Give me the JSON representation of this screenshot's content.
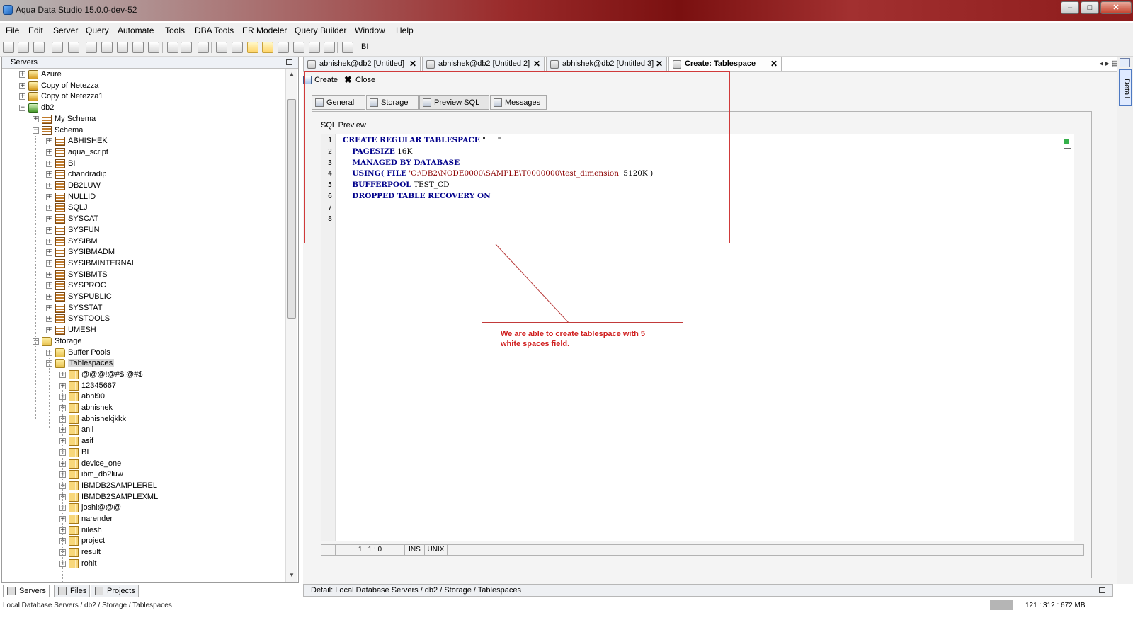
{
  "window": {
    "title": "Aqua Data Studio 15.0.0-dev-52",
    "min": "–",
    "max": "□",
    "close": "✕"
  },
  "menu": [
    "File",
    "Edit",
    "Server",
    "Query",
    "Automate",
    "Tools",
    "DBA Tools",
    "ER Modeler",
    "Query Builder",
    "Window",
    "Help"
  ],
  "toolbar": {
    "bi_label": "BI"
  },
  "servers_panel": {
    "title": "Servers"
  },
  "tree": [
    {
      "label": "Azure",
      "level": 0,
      "icon": "server-icon",
      "expanded": false
    },
    {
      "label": "Copy of Netezza",
      "level": 0,
      "icon": "server-icon",
      "expanded": false
    },
    {
      "label": "Copy of Netezza1",
      "level": 0,
      "icon": "server-icon",
      "expanded": false
    },
    {
      "label": "db2",
      "level": 0,
      "icon": "db2-icon",
      "expanded": true
    },
    {
      "label": "My Schema",
      "level": 1,
      "icon": "schema-icon",
      "expanded": false
    },
    {
      "label": "Schema",
      "level": 1,
      "icon": "schema-icon",
      "expanded": true
    },
    {
      "label": "ABHISHEK",
      "level": 2,
      "icon": "schema-icon",
      "expanded": false
    },
    {
      "label": "aqua_script",
      "level": 2,
      "icon": "schema-icon",
      "expanded": false
    },
    {
      "label": "BI",
      "level": 2,
      "icon": "schema-icon",
      "expanded": false
    },
    {
      "label": "chandradip",
      "level": 2,
      "icon": "schema-icon",
      "expanded": false
    },
    {
      "label": "DB2LUW",
      "level": 2,
      "icon": "schema-icon",
      "expanded": false
    },
    {
      "label": "NULLID",
      "level": 2,
      "icon": "schema-icon",
      "expanded": false
    },
    {
      "label": "SQLJ",
      "level": 2,
      "icon": "schema-icon",
      "expanded": false
    },
    {
      "label": "SYSCAT",
      "level": 2,
      "icon": "schema-icon",
      "expanded": false
    },
    {
      "label": "SYSFUN",
      "level": 2,
      "icon": "schema-icon",
      "expanded": false
    },
    {
      "label": "SYSIBM",
      "level": 2,
      "icon": "schema-icon",
      "expanded": false
    },
    {
      "label": "SYSIBMADM",
      "level": 2,
      "icon": "schema-icon",
      "expanded": false
    },
    {
      "label": "SYSIBMINTERNAL",
      "level": 2,
      "icon": "schema-icon",
      "expanded": false
    },
    {
      "label": "SYSIBMTS",
      "level": 2,
      "icon": "schema-icon",
      "expanded": false
    },
    {
      "label": "SYSPROC",
      "level": 2,
      "icon": "schema-icon",
      "expanded": false
    },
    {
      "label": "SYSPUBLIC",
      "level": 2,
      "icon": "schema-icon",
      "expanded": false
    },
    {
      "label": "SYSSTAT",
      "level": 2,
      "icon": "schema-icon",
      "expanded": false
    },
    {
      "label": "SYSTOOLS",
      "level": 2,
      "icon": "schema-icon",
      "expanded": false
    },
    {
      "label": "UMESH",
      "level": 2,
      "icon": "schema-icon",
      "expanded": false
    },
    {
      "label": "Storage",
      "level": 1,
      "icon": "folder-icon",
      "expanded": true
    },
    {
      "label": "Buffer Pools",
      "level": 2,
      "icon": "folder-icon",
      "expanded": false
    },
    {
      "label": "Tablespaces",
      "level": 2,
      "icon": "folder-icon",
      "expanded": true,
      "selected": true
    },
    {
      "label": "@@@!@#$!@#$",
      "level": 3,
      "icon": "tablespace-icon",
      "expanded": false
    },
    {
      "label": "12345667",
      "level": 3,
      "icon": "tablespace-icon",
      "expanded": false
    },
    {
      "label": "abhi90",
      "level": 3,
      "icon": "tablespace-icon",
      "expanded": false
    },
    {
      "label": "abhishek",
      "level": 3,
      "icon": "tablespace-icon",
      "expanded": false
    },
    {
      "label": "abhishekjkkk",
      "level": 3,
      "icon": "tablespace-icon",
      "expanded": false
    },
    {
      "label": "anil",
      "level": 3,
      "icon": "tablespace-icon",
      "expanded": false
    },
    {
      "label": "asif",
      "level": 3,
      "icon": "tablespace-icon",
      "expanded": false
    },
    {
      "label": "BI",
      "level": 3,
      "icon": "tablespace-icon",
      "expanded": false
    },
    {
      "label": "device_one",
      "level": 3,
      "icon": "tablespace-icon",
      "expanded": false
    },
    {
      "label": "ibm_db2luw",
      "level": 3,
      "icon": "tablespace-icon",
      "expanded": false
    },
    {
      "label": "IBMDB2SAMPLEREL",
      "level": 3,
      "icon": "tablespace-icon",
      "expanded": false
    },
    {
      "label": "IBMDB2SAMPLEXML",
      "level": 3,
      "icon": "tablespace-icon",
      "expanded": false
    },
    {
      "label": "joshi@@@",
      "level": 3,
      "icon": "tablespace-icon",
      "expanded": false
    },
    {
      "label": "narender",
      "level": 3,
      "icon": "tablespace-icon",
      "expanded": false
    },
    {
      "label": "nilesh",
      "level": 3,
      "icon": "tablespace-icon",
      "expanded": false
    },
    {
      "label": "project",
      "level": 3,
      "icon": "tablespace-icon",
      "expanded": false
    },
    {
      "label": "result",
      "level": 3,
      "icon": "tablespace-icon",
      "expanded": false
    },
    {
      "label": "rohit",
      "level": 3,
      "icon": "tablespace-icon",
      "expanded": false
    }
  ],
  "left_tabs": [
    {
      "label": "Servers",
      "icon": "servers-icon",
      "active": true
    },
    {
      "label": "Files",
      "icon": "files-icon",
      "active": false
    },
    {
      "label": "Projects",
      "icon": "projects-icon",
      "active": false
    }
  ],
  "editor_tabs": [
    {
      "label": "abhishek@db2 [Untitled]",
      "active": false
    },
    {
      "label": "abhishek@db2 [Untitled 2]",
      "active": false
    },
    {
      "label": "abhishek@db2 [Untitled 3]",
      "active": false
    },
    {
      "label": "Create: Tablespace",
      "active": true
    }
  ],
  "tab_close": "✕",
  "tab_nav": "◂ ▸ ▤",
  "right_strip": {
    "detail_label": "Detail"
  },
  "create_toolbar": {
    "create_label": "Create",
    "close_label": "Close",
    "close_glyph": "✖"
  },
  "inner_tabs": [
    {
      "label": "General",
      "active": false
    },
    {
      "label": "Storage",
      "active": false
    },
    {
      "label": "Preview SQL",
      "active": true
    },
    {
      "label": "Messages",
      "active": false
    }
  ],
  "sql_preview": {
    "title": "SQL Preview",
    "line_numbers": [
      "1",
      "2",
      "3",
      "4",
      "5",
      "6",
      "7",
      "8"
    ],
    "lines": [
      {
        "kw1": "CREATE REGULAR TABLESPACE",
        "rest": " \"     \""
      },
      {
        "indent": "    ",
        "kw1": "PAGESIZE",
        "rest": " 16K"
      },
      {
        "indent": "    ",
        "kw1": "MANAGED BY DATABASE",
        "rest": ""
      },
      {
        "indent": "    ",
        "kw1": "USING( FILE",
        "str": " 'C:\\DB2\\NODE0000\\SAMPLE\\T0000000\\test_dimension'",
        "rest": " 5120K )"
      },
      {
        "indent": "    ",
        "kw1": "BUFFERPOOL",
        "rest": " TEST_CD"
      },
      {
        "indent": "    ",
        "kw1": "DROPPED TABLE RECOVERY ON",
        "rest": ""
      },
      {
        "rest": ""
      },
      {
        "rest": ""
      }
    ]
  },
  "editor_status": {
    "position": "1 | 1 : 0",
    "mode": "INS",
    "line_ending": "UNIX"
  },
  "annotation": {
    "callout": "We are able to create tablespace with 5 white spaces field."
  },
  "detail_bar": {
    "label": "Detail: Local Database Servers / db2 / Storage / Tablespaces"
  },
  "status_bar": {
    "path": "Local Database Servers / db2 / Storage / Tablespaces",
    "memory": "121 : 312 : 672 MB"
  },
  "colors": {
    "accent_red": "#d01f1f",
    "keyword": "#00008b",
    "string": "#8b0000"
  }
}
